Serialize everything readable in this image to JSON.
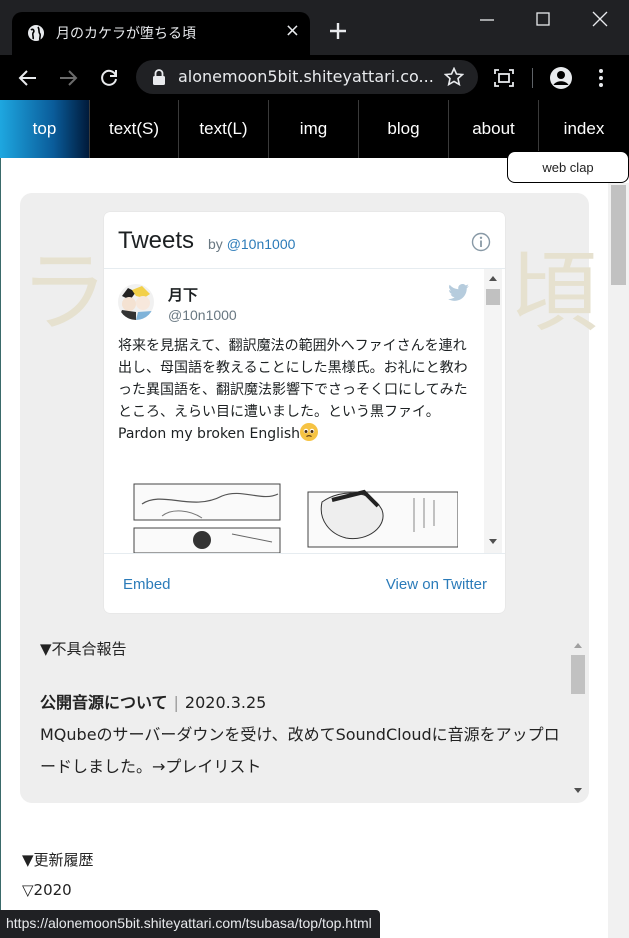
{
  "browser": {
    "tab_title": "月のカケラが堕ちる頃",
    "tab_close": "×",
    "url": "alonemoon5bit.shiteyattari.co...",
    "status_url": "https://alonemoon5bit.shiteyattari.com/tsubasa/top/top.html"
  },
  "nav": {
    "items": [
      {
        "label": "top",
        "active": true
      },
      {
        "label": "text(S)"
      },
      {
        "label": "text(L)"
      },
      {
        "label": "img"
      },
      {
        "label": "blog"
      },
      {
        "label": "about"
      },
      {
        "label": "index"
      }
    ],
    "web_clap": "web clap"
  },
  "decor": {
    "left_glyph": "ラ",
    "right_glyph": "頃"
  },
  "tweets": {
    "title": "Tweets",
    "by": "by",
    "handle": "@10n1000",
    "tweet": {
      "name": "月下",
      "username": "@10n1000",
      "text": "将来を見据えて、翻訳魔法の範囲外へファイさんを連れ出し、母国語を教えることにした黒様氏。お礼にと教わった異国語を、翻訳魔法影響下でさっそく口にしてみたところ、えらい目に遭いました。という黒ファイ。Pardon my broken English"
    },
    "embed": "Embed",
    "view_on_twitter": "View on Twitter"
  },
  "bug_report": {
    "heading": "▼不具合報告",
    "title": "公開音源について",
    "date": "2020.3.25",
    "body": "MQubeのサーバーダウンを受け、改めてSoundCloudに音源をアップロードしました。→プレイリスト"
  },
  "updates": {
    "heading": "▼更新履歴",
    "year": "▽2020"
  }
}
